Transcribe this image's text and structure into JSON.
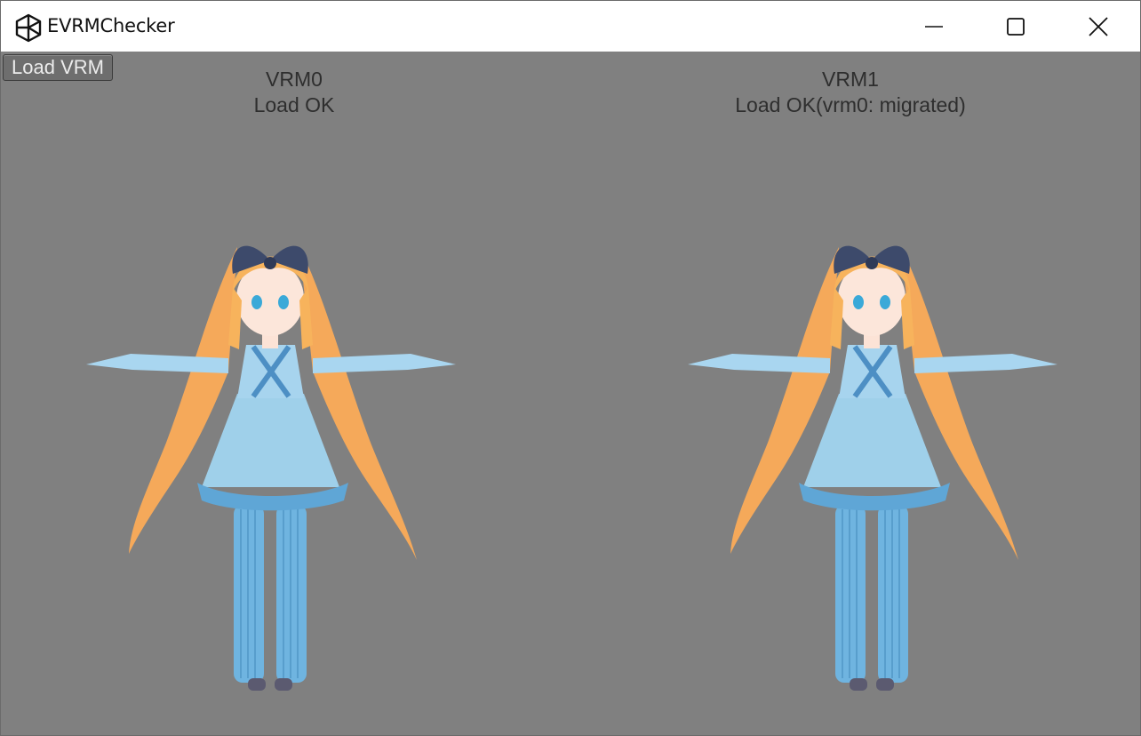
{
  "window": {
    "title": "EVRMChecker",
    "icon": "unity-icon",
    "controls": [
      "minimize-icon",
      "maximize-icon",
      "close-icon"
    ]
  },
  "toolbar": {
    "load_label": "Load VRM"
  },
  "panels": [
    {
      "heading": "VRM0",
      "status": "Load OK",
      "figure": "avatar-3d-model"
    },
    {
      "heading": "VRM1",
      "status": "Load OK(vrm0: migrated)",
      "figure": "avatar-3d-model"
    }
  ],
  "colors": {
    "viewport": "#808080",
    "titlebar": "#ffffff",
    "label_text": "#2e2e2e",
    "hair": "#f7b35c",
    "dress": "#9fd0ea",
    "ribbon": "#3d4a6b",
    "stockings": "#6fb4e0"
  }
}
